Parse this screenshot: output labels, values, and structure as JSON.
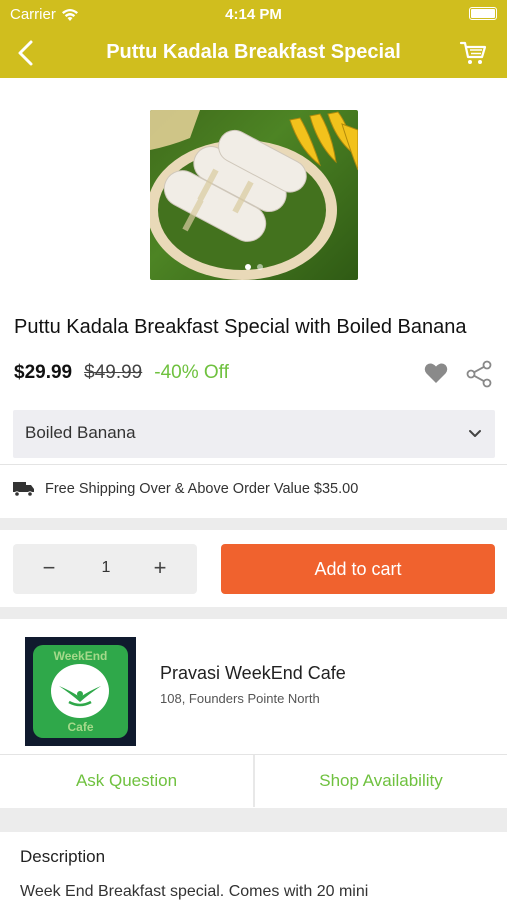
{
  "status_bar": {
    "carrier": "Carrier",
    "time": "4:14 PM",
    "wifi_icon": "wifi-icon",
    "battery_icon": "battery-icon"
  },
  "nav": {
    "title": "Puttu Kadala Breakfast Special",
    "back_icon": "chevron-left-icon",
    "cart_icon": "cart-icon"
  },
  "product": {
    "name": "Puttu Kadala Breakfast Special with Boiled Banana",
    "price": "$29.99",
    "old_price": "$49.99",
    "discount": "-40% Off",
    "image_slide_current": 1,
    "image_slide_total": 2,
    "wishlist_icon": "heart-icon",
    "share_icon": "share-icon"
  },
  "variant": {
    "selected": "Boiled Banana",
    "dropdown_icon": "chevron-down-icon"
  },
  "shipping": {
    "icon": "truck-icon",
    "text": "Free Shipping Over & Above Order Value $35.00"
  },
  "cart": {
    "quantity": "1",
    "minus_label": "−",
    "plus_label": "+",
    "add_label": "Add to cart"
  },
  "shop": {
    "name": "Pravasi WeekEnd Cafe",
    "address": "108, Founders Pointe North",
    "logo_text_top": "WeekEnd",
    "logo_text_bottom": "Cafe"
  },
  "actions": {
    "ask_question": "Ask Question",
    "shop_availability": "Shop Availability"
  },
  "description": {
    "title": "Description",
    "text": "Week End Breakfast special. Comes with 20 mini"
  },
  "colors": {
    "nav_bar": "#d0be1e",
    "accent_green": "#6fc13f",
    "cart_button": "#f0622e"
  }
}
